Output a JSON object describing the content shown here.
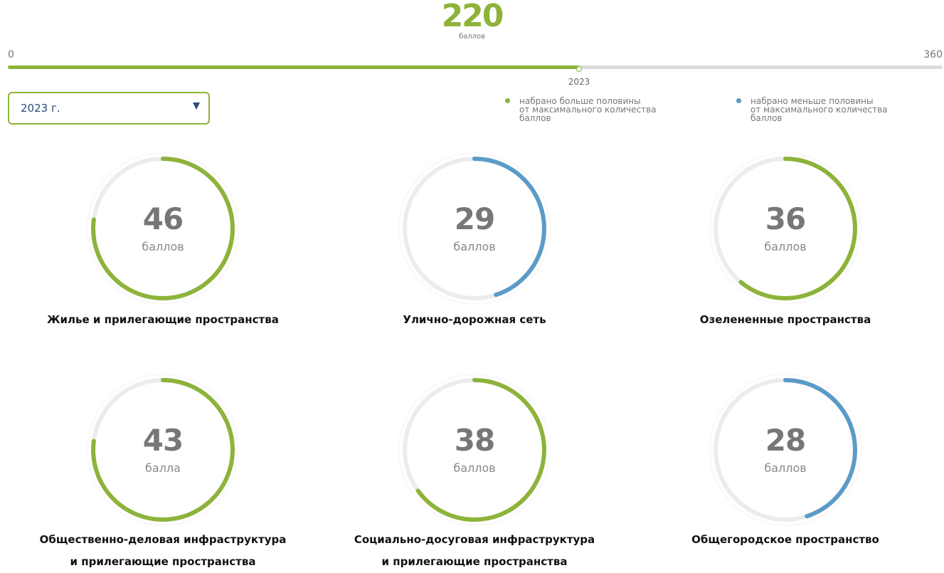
{
  "summary": {
    "total": "220",
    "total_unit": "баллов",
    "scale_min": "0",
    "scale_max": "360",
    "scale_min_value": 0,
    "scale_max_value": 360,
    "marker_year": "2023"
  },
  "year_select": {
    "value": "2023 г."
  },
  "legend": [
    {
      "text": "набрано больше половины\nот максимального количества\nбаллов",
      "color": "#8db33a"
    },
    {
      "text": "набрано меньше половины\nот максимального количества\nбаллов",
      "color": "#5b9bc7"
    }
  ],
  "colors": {
    "green": "#8db33a",
    "blue": "#5b9bc7",
    "track": "#ececec",
    "select_text": "#2c4a78"
  },
  "categories": [
    {
      "value": "46",
      "unit": "баллов",
      "title": "Жилье и прилегающие пространства",
      "fill": 0.77,
      "status": "green"
    },
    {
      "value": "29",
      "unit": "баллов",
      "title": "Улично-дорожная сеть",
      "fill": 0.45,
      "status": "blue"
    },
    {
      "value": "36",
      "unit": "баллов",
      "title": "Озелененные пространства",
      "fill": 0.61,
      "status": "green"
    },
    {
      "value": "43",
      "unit": "балла",
      "title": "Общественно-деловая инфраструктура\nи прилегающие пространства",
      "fill": 0.77,
      "status": "green"
    },
    {
      "value": "38",
      "unit": "баллов",
      "title": "Социально-досуговая инфраструктура\nи прилегающие пространства",
      "fill": 0.65,
      "status": "green"
    },
    {
      "value": "28",
      "unit": "баллов",
      "title": "Общегородское пространство",
      "fill": 0.45,
      "status": "blue"
    }
  ]
}
